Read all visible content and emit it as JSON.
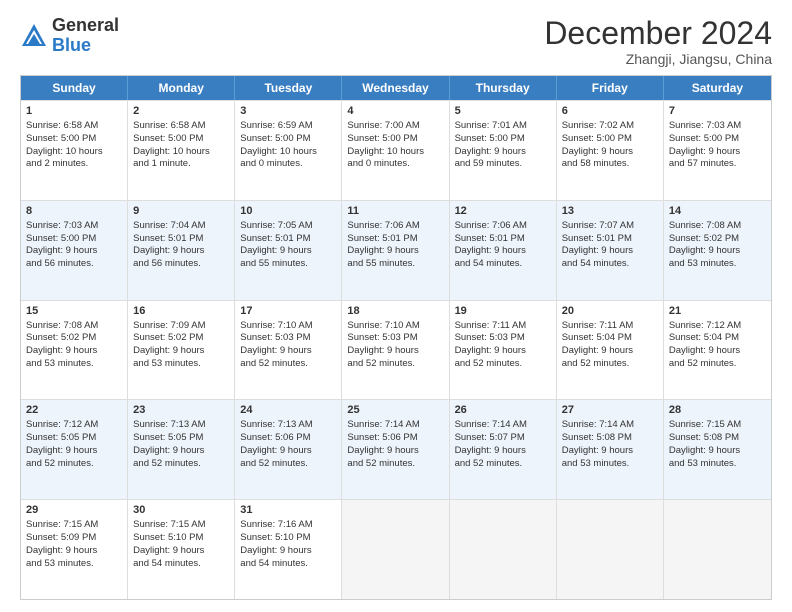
{
  "logo": {
    "general": "General",
    "blue": "Blue"
  },
  "title": "December 2024",
  "subtitle": "Zhangji, Jiangsu, China",
  "header_days": [
    "Sunday",
    "Monday",
    "Tuesday",
    "Wednesday",
    "Thursday",
    "Friday",
    "Saturday"
  ],
  "rows": [
    [
      {
        "day": "1",
        "lines": [
          "Sunrise: 6:58 AM",
          "Sunset: 5:00 PM",
          "Daylight: 10 hours",
          "and 2 minutes."
        ]
      },
      {
        "day": "2",
        "lines": [
          "Sunrise: 6:58 AM",
          "Sunset: 5:00 PM",
          "Daylight: 10 hours",
          "and 1 minute."
        ]
      },
      {
        "day": "3",
        "lines": [
          "Sunrise: 6:59 AM",
          "Sunset: 5:00 PM",
          "Daylight: 10 hours",
          "and 0 minutes."
        ]
      },
      {
        "day": "4",
        "lines": [
          "Sunrise: 7:00 AM",
          "Sunset: 5:00 PM",
          "Daylight: 10 hours",
          "and 0 minutes."
        ]
      },
      {
        "day": "5",
        "lines": [
          "Sunrise: 7:01 AM",
          "Sunset: 5:00 PM",
          "Daylight: 9 hours",
          "and 59 minutes."
        ]
      },
      {
        "day": "6",
        "lines": [
          "Sunrise: 7:02 AM",
          "Sunset: 5:00 PM",
          "Daylight: 9 hours",
          "and 58 minutes."
        ]
      },
      {
        "day": "7",
        "lines": [
          "Sunrise: 7:03 AM",
          "Sunset: 5:00 PM",
          "Daylight: 9 hours",
          "and 57 minutes."
        ]
      }
    ],
    [
      {
        "day": "8",
        "lines": [
          "Sunrise: 7:03 AM",
          "Sunset: 5:00 PM",
          "Daylight: 9 hours",
          "and 56 minutes."
        ]
      },
      {
        "day": "9",
        "lines": [
          "Sunrise: 7:04 AM",
          "Sunset: 5:01 PM",
          "Daylight: 9 hours",
          "and 56 minutes."
        ]
      },
      {
        "day": "10",
        "lines": [
          "Sunrise: 7:05 AM",
          "Sunset: 5:01 PM",
          "Daylight: 9 hours",
          "and 55 minutes."
        ]
      },
      {
        "day": "11",
        "lines": [
          "Sunrise: 7:06 AM",
          "Sunset: 5:01 PM",
          "Daylight: 9 hours",
          "and 55 minutes."
        ]
      },
      {
        "day": "12",
        "lines": [
          "Sunrise: 7:06 AM",
          "Sunset: 5:01 PM",
          "Daylight: 9 hours",
          "and 54 minutes."
        ]
      },
      {
        "day": "13",
        "lines": [
          "Sunrise: 7:07 AM",
          "Sunset: 5:01 PM",
          "Daylight: 9 hours",
          "and 54 minutes."
        ]
      },
      {
        "day": "14",
        "lines": [
          "Sunrise: 7:08 AM",
          "Sunset: 5:02 PM",
          "Daylight: 9 hours",
          "and 53 minutes."
        ]
      }
    ],
    [
      {
        "day": "15",
        "lines": [
          "Sunrise: 7:08 AM",
          "Sunset: 5:02 PM",
          "Daylight: 9 hours",
          "and 53 minutes."
        ]
      },
      {
        "day": "16",
        "lines": [
          "Sunrise: 7:09 AM",
          "Sunset: 5:02 PM",
          "Daylight: 9 hours",
          "and 53 minutes."
        ]
      },
      {
        "day": "17",
        "lines": [
          "Sunrise: 7:10 AM",
          "Sunset: 5:03 PM",
          "Daylight: 9 hours",
          "and 52 minutes."
        ]
      },
      {
        "day": "18",
        "lines": [
          "Sunrise: 7:10 AM",
          "Sunset: 5:03 PM",
          "Daylight: 9 hours",
          "and 52 minutes."
        ]
      },
      {
        "day": "19",
        "lines": [
          "Sunrise: 7:11 AM",
          "Sunset: 5:03 PM",
          "Daylight: 9 hours",
          "and 52 minutes."
        ]
      },
      {
        "day": "20",
        "lines": [
          "Sunrise: 7:11 AM",
          "Sunset: 5:04 PM",
          "Daylight: 9 hours",
          "and 52 minutes."
        ]
      },
      {
        "day": "21",
        "lines": [
          "Sunrise: 7:12 AM",
          "Sunset: 5:04 PM",
          "Daylight: 9 hours",
          "and 52 minutes."
        ]
      }
    ],
    [
      {
        "day": "22",
        "lines": [
          "Sunrise: 7:12 AM",
          "Sunset: 5:05 PM",
          "Daylight: 9 hours",
          "and 52 minutes."
        ]
      },
      {
        "day": "23",
        "lines": [
          "Sunrise: 7:13 AM",
          "Sunset: 5:05 PM",
          "Daylight: 9 hours",
          "and 52 minutes."
        ]
      },
      {
        "day": "24",
        "lines": [
          "Sunrise: 7:13 AM",
          "Sunset: 5:06 PM",
          "Daylight: 9 hours",
          "and 52 minutes."
        ]
      },
      {
        "day": "25",
        "lines": [
          "Sunrise: 7:14 AM",
          "Sunset: 5:06 PM",
          "Daylight: 9 hours",
          "and 52 minutes."
        ]
      },
      {
        "day": "26",
        "lines": [
          "Sunrise: 7:14 AM",
          "Sunset: 5:07 PM",
          "Daylight: 9 hours",
          "and 52 minutes."
        ]
      },
      {
        "day": "27",
        "lines": [
          "Sunrise: 7:14 AM",
          "Sunset: 5:08 PM",
          "Daylight: 9 hours",
          "and 53 minutes."
        ]
      },
      {
        "day": "28",
        "lines": [
          "Sunrise: 7:15 AM",
          "Sunset: 5:08 PM",
          "Daylight: 9 hours",
          "and 53 minutes."
        ]
      }
    ],
    [
      {
        "day": "29",
        "lines": [
          "Sunrise: 7:15 AM",
          "Sunset: 5:09 PM",
          "Daylight: 9 hours",
          "and 53 minutes."
        ]
      },
      {
        "day": "30",
        "lines": [
          "Sunrise: 7:15 AM",
          "Sunset: 5:10 PM",
          "Daylight: 9 hours",
          "and 54 minutes."
        ]
      },
      {
        "day": "31",
        "lines": [
          "Sunrise: 7:16 AM",
          "Sunset: 5:10 PM",
          "Daylight: 9 hours",
          "and 54 minutes."
        ]
      },
      {
        "day": "",
        "lines": []
      },
      {
        "day": "",
        "lines": []
      },
      {
        "day": "",
        "lines": []
      },
      {
        "day": "",
        "lines": []
      }
    ]
  ]
}
